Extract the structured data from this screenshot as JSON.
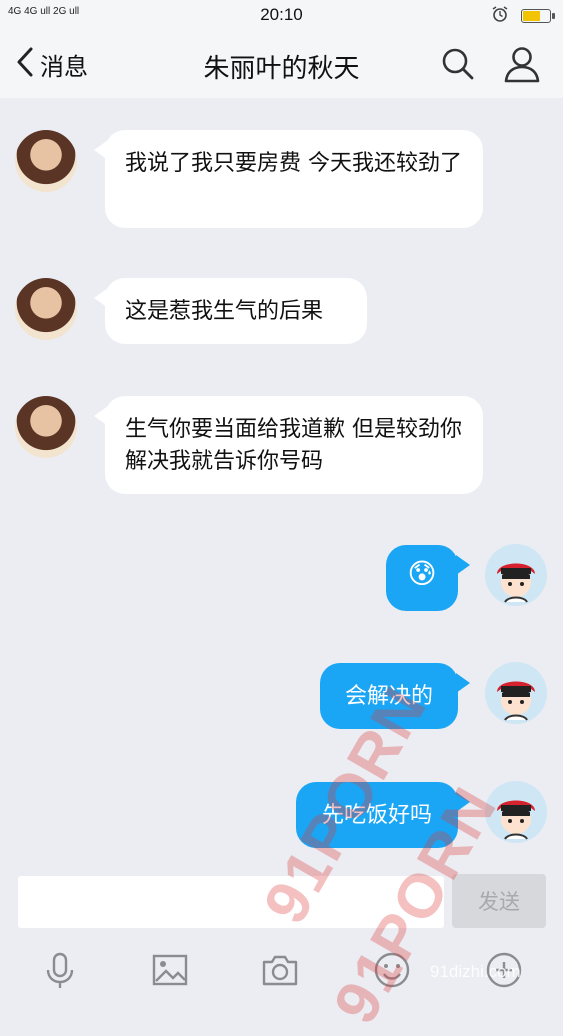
{
  "status_bar": {
    "network": "4G 4G ull 2G ull",
    "time": "20:10"
  },
  "header": {
    "back_label": "消息",
    "title": "朱丽叶的秋天"
  },
  "messages": [
    {
      "side": "in",
      "text": "我说了我只要房费  今天我还较劲了"
    },
    {
      "side": "in",
      "text": "这是惹我生气的后果"
    },
    {
      "side": "in",
      "text": "生气你要当面给我道歉 但是较劲你解决我就告诉你号码"
    },
    {
      "side": "out",
      "text": "😰"
    },
    {
      "side": "out",
      "text": "会解决的"
    },
    {
      "side": "out",
      "text": "先吃饭好吗"
    }
  ],
  "composer": {
    "input_value": "",
    "send_label": "发送"
  },
  "toolbar": {
    "icons": [
      "microphone-icon",
      "image-icon",
      "camera-icon",
      "emoji-icon",
      "more-icon"
    ]
  },
  "watermark": {
    "text_1": "91PORN",
    "text_2": "91PORN",
    "site": "91dizhi.com"
  },
  "colors": {
    "bubble_outgoing": "#1aa6f5",
    "bubble_incoming": "#ffffff",
    "background": "#ebedf2"
  }
}
